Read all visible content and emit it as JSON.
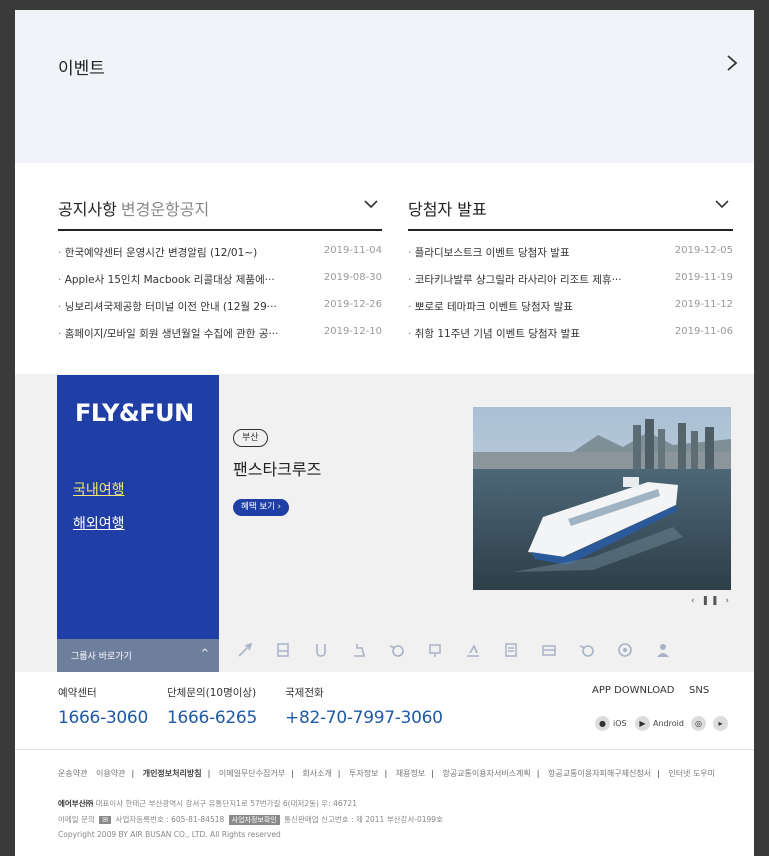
{
  "events": {
    "title": "이벤트"
  },
  "notices": {
    "title": "공지사항",
    "subtitle": "변경운항공지",
    "items": [
      {
        "title": "한국예약센터 운영시간 변경알림 (12/01~)",
        "date": "2019-11-04"
      },
      {
        "title": "Apple사 15인치 Macbook 리콜대상 제품에···",
        "date": "2019-08-30"
      },
      {
        "title": "닝보리셔국제공항 터미널 이전 안내 (12월 29···",
        "date": "2019-12-26"
      },
      {
        "title": "홈페이지/모바일 회원 생년월일 수집에 관한 공···",
        "date": "2019-12-10"
      }
    ]
  },
  "winners": {
    "title": "당첨자 발표",
    "items": [
      {
        "title": "플라디보스트크 이벤트 당첨자 발표",
        "date": "2019-12-05"
      },
      {
        "title": "코타키나발루 샹그릴라 라사리아 리조트 제휴···",
        "date": "2019-11-19"
      },
      {
        "title": "뽀로로 테마파크 이벤트 당첨자 발표",
        "date": "2019-11-12"
      },
      {
        "title": "취항 11주년 기념 이벤트 당첨자 발표",
        "date": "2019-11-06"
      }
    ]
  },
  "promo": {
    "title": "FLY&FUN",
    "domestic": "국내여행",
    "overseas": "해외여행",
    "group_shortcut": "그룹사 바로가기",
    "region": "부산",
    "name": "팬스타크루즈",
    "benefit_button": "혜택 보기 ›",
    "slide_controls": "‹ ❚❚ ›"
  },
  "contact": {
    "reservation_label": "예약센터",
    "reservation_number": "1666-3060",
    "group_label": "단체문의(10명이상)",
    "group_number": "1666-6265",
    "intl_label": "국제전화",
    "intl_number": "+82-70-7997-3060",
    "app_download": "APP DOWNLOAD",
    "sns": "SNS",
    "ios": "iOS",
    "android": "Android"
  },
  "footer": {
    "links": [
      "운송약관",
      "이용약관",
      "개인정보처리방침",
      "이메일무단수집거부",
      "회사소개",
      "투자정보",
      "채용정보",
      "항공교통이용자서비스계획",
      "항공교통이용자피해구제신청서",
      "인터넷 도우미"
    ],
    "company": "에어부산㈜",
    "address": "대표이사 한태근 부산광역시 강서구 유통단지1로 57번가길 6(대저2동) 우: 46721",
    "email_label": "이메일 문의",
    "biz_no": "사업자등록번호 : 605-81-84518",
    "biz_check": "사업자정보확인",
    "mail_order": "통신판매업 신고번호 : 제 2011 부산강서-0199호",
    "copyright": "Copyright 2009 BY AIR BUSAN CO., LTD. All Rights reserved"
  },
  "colors": {
    "brand_blue": "#1f3fa6",
    "link_blue": "#1f5aa8",
    "highlight_yellow": "#f1e86a"
  }
}
